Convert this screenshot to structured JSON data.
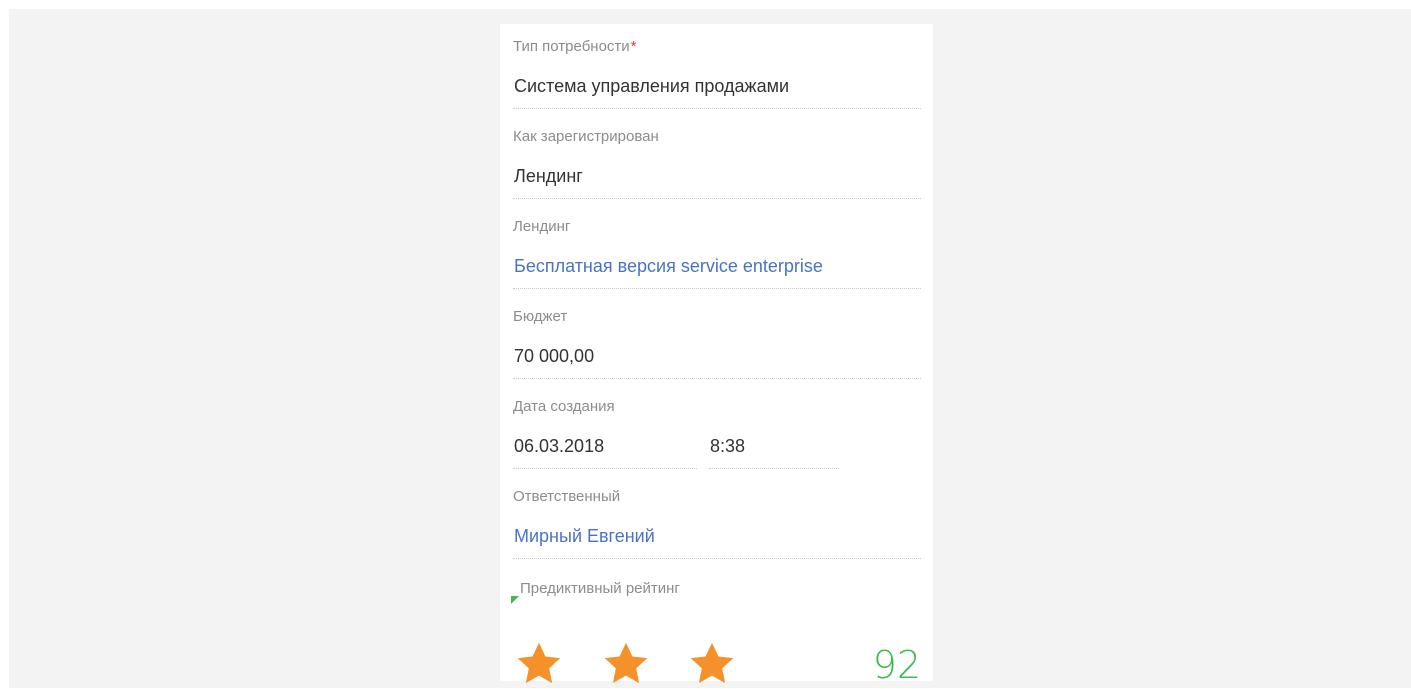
{
  "fields": {
    "need_type": {
      "label": "Тип потребности",
      "required_mark": "*",
      "value": "Система управления продажами"
    },
    "registered_how": {
      "label": "Как зарегистрирован",
      "value": "Лендинг"
    },
    "landing": {
      "label": "Лендинг",
      "value": "Бесплатная версия service enterprise"
    },
    "budget": {
      "label": "Бюджет",
      "value": "70 000,00"
    },
    "created": {
      "label": "Дата создания",
      "date": "06.03.2018",
      "time": "8:38"
    },
    "owner": {
      "label": "Ответственный",
      "value": "Мирный Евгений"
    },
    "predictive_rating": {
      "label": "Предиктивный рейтинг",
      "stars": 3,
      "score": "92"
    }
  },
  "colors": {
    "background": "#f3f3f3",
    "card": "#ffffff",
    "label": "#8c8c8c",
    "value": "#333333",
    "link": "#4a73c7",
    "required": "#e53935",
    "star": "#f5912b",
    "score": "#3fb950"
  },
  "icons": {
    "rating_star": "star-icon",
    "corner_marker": "corner-indicator-icon"
  }
}
